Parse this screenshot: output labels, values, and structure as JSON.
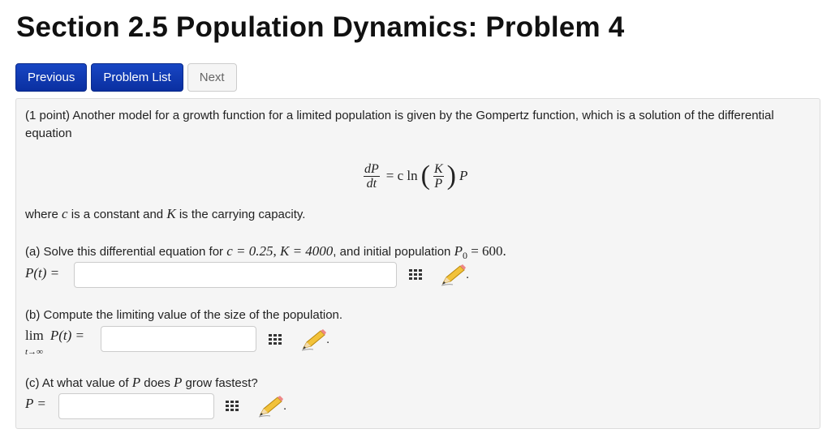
{
  "page": {
    "title": "Section 2.5 Population Dynamics: Problem 4"
  },
  "nav": {
    "previous": "Previous",
    "problem_list": "Problem List",
    "next": "Next"
  },
  "problem": {
    "intro": "(1 point) Another model for a growth function for a limited population is given by the Gompertz function, which is a solution of the differential equation",
    "equation": {
      "lhs_num": "dP",
      "lhs_den": "dt",
      "equals": "= c ln",
      "inner_num": "K",
      "inner_den": "P",
      "tail": "P"
    },
    "where_pre": "where ",
    "where_c": "c",
    "where_mid": " is a constant and ",
    "where_K": "K",
    "where_post": " is the carrying capacity.",
    "part_a": {
      "text_pre": "(a) Solve this differential equation for ",
      "c_eq": "c = 0.25",
      "sep1": ", ",
      "k_eq": "K = 4000",
      "text_mid": ", and initial population ",
      "p0_eq": "P",
      "p0_sub": "0",
      "p0_val": " = 600.",
      "label": "P(t) =",
      "value": ""
    },
    "part_b": {
      "text": "(b) Compute the limiting value of the size of the population.",
      "label_lim": "lim",
      "label_sub": "t→∞",
      "label_rest": "P(t) =",
      "value": ""
    },
    "part_c": {
      "text_pre": "(c) At what value of ",
      "p1": "P",
      "text_mid": " does ",
      "p2": "P",
      "text_post": " grow fastest?",
      "label": "P =",
      "value": ""
    },
    "period": "."
  },
  "icons": {
    "palette": "equation-editor-icon",
    "pencil": "pencil-icon"
  },
  "colors": {
    "primary_button": "#0a2fa0",
    "panel_bg": "#f5f5f5"
  }
}
